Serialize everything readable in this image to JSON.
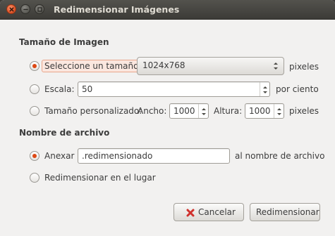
{
  "window": {
    "title": "Redimensionar Imágenes"
  },
  "size_section": {
    "heading": "Tamaño de Imagen",
    "option_preset": {
      "label": "Seleccione un tamaño:",
      "selected": true,
      "combo_value": "1024x768",
      "unit": "pixeles"
    },
    "option_scale": {
      "label": "Escala:",
      "selected": false,
      "value": "50",
      "unit": "por ciento"
    },
    "option_custom": {
      "label": "Tamaño personalizado:",
      "selected": false,
      "width_label": "Ancho:",
      "width_value": "1000",
      "height_label": "Altura:",
      "height_value": "1000",
      "unit": "pixeles"
    }
  },
  "filename_section": {
    "heading": "Nombre de archivo",
    "option_append": {
      "label": "Anexar",
      "selected": true,
      "value": ".redimensionado",
      "suffix": "al nombre de archivo"
    },
    "option_inplace": {
      "label": "Redimensionar en el lugar",
      "selected": false
    }
  },
  "buttons": {
    "cancel": "Cancelar",
    "resize": "Redimensionar"
  },
  "colors": {
    "accent": "#dd4814",
    "titlebar": "#3c3b37",
    "background": "#f2f1f0",
    "cancel_icon": "#d0312d"
  },
  "icons": {
    "close": "close-icon",
    "minimize": "minimize-icon",
    "maximize": "maximize-icon",
    "cancel": "cancel-x-icon"
  }
}
